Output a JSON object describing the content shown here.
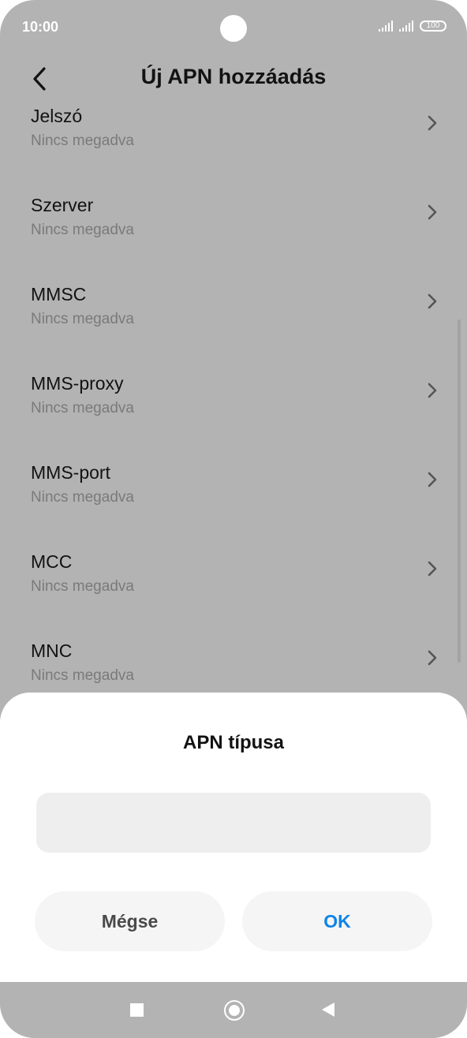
{
  "status_bar": {
    "time": "10:00",
    "battery": "100"
  },
  "header": {
    "title": "Új APN hozzáadás"
  },
  "list": {
    "items": [
      {
        "title": "Jelszó",
        "value": "Nincs megadva"
      },
      {
        "title": "Szerver",
        "value": "Nincs megadva"
      },
      {
        "title": "MMSC",
        "value": "Nincs megadva"
      },
      {
        "title": "MMS-proxy",
        "value": "Nincs megadva"
      },
      {
        "title": "MMS-port",
        "value": "Nincs megadva"
      },
      {
        "title": "MCC",
        "value": "Nincs megadva"
      },
      {
        "title": "MNC",
        "value": "Nincs megadva"
      }
    ]
  },
  "dialog": {
    "title": "APN típusa",
    "input_value": "",
    "cancel_label": "Mégse",
    "ok_label": "OK"
  },
  "colors": {
    "accent": "#0d84e8",
    "overlay": "#b3b3b3"
  },
  "icons": {
    "back": "back-arrow-icon",
    "chevron": "chevron-right-icon",
    "recent": "square-icon",
    "home": "circle-icon",
    "nav_back": "triangle-back-icon"
  }
}
